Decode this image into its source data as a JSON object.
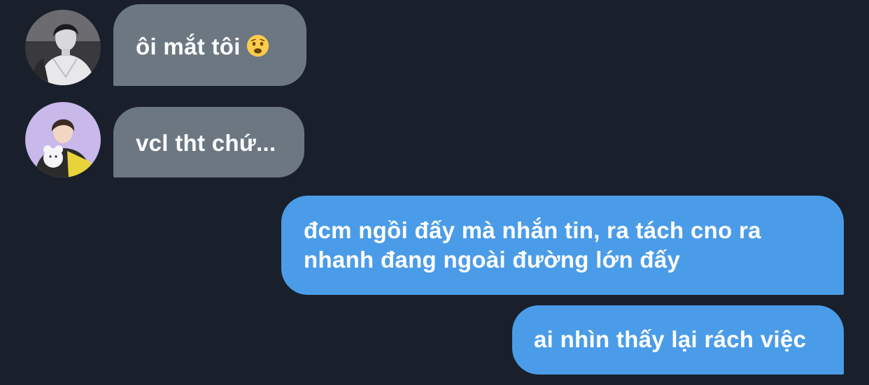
{
  "conversation": {
    "messages": [
      {
        "direction": "incoming",
        "text": "ôi mắt tôi",
        "emoji": "worried-face-emoji",
        "avatar": "avatar-1"
      },
      {
        "direction": "incoming",
        "text": "vcl tht chứ...",
        "avatar": "avatar-2"
      },
      {
        "direction": "outgoing",
        "lines": [
          "đcm ngồi đấy mà nhắn tin, ra tách cno ra",
          "nhanh đang ngoài đường lớn đấy"
        ]
      },
      {
        "direction": "outgoing",
        "text": "ai nhìn thấy lại rách việc"
      }
    ]
  },
  "colors": {
    "background": "#19202b",
    "incoming_bubble": "#6c7782",
    "outgoing_bubble": "#4b9ce8",
    "text": "#ffffff"
  }
}
